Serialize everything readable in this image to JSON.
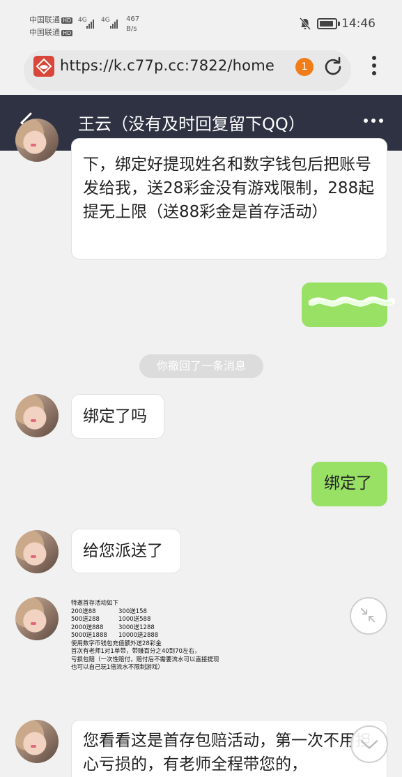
{
  "status_bar": {
    "carrier_1": "中国联通",
    "carrier_2": "中国联通",
    "hd": "HD",
    "signal_1": "4G",
    "signal_2": "4G",
    "speed_value": "467",
    "speed_unit": "B/s",
    "time": "14:46"
  },
  "browser": {
    "url": "https://k.c77p.cc:7822/home",
    "tab_count": "1"
  },
  "chat": {
    "title": "王云（没有及时回复留下QQ）",
    "messages": {
      "m1": "下，绑定好提现姓名和数字钱包后把账号发给我，送28彩金没有游戏限制，288起提无上限（送88彩金是首存活动）",
      "recall": "你撤回了一条消息",
      "m3": "绑定了吗",
      "m4": "绑定了",
      "m5": "给您派送了",
      "m7": "您看看这是首存包赔活动，第一次不用担心亏损的，有老师全程带您的，"
    },
    "promo": {
      "title": "特邀首存活动如下",
      "rows": [
        [
          "200送88",
          "300送158"
        ],
        [
          "500送288",
          "1000送588"
        ],
        [
          "2000送888",
          "3000送1288"
        ],
        [
          "5000送1888",
          "10000送2888"
        ]
      ],
      "line1": "使用数字币钱包充值额外送28彩金",
      "line2": "首次有老师1对1单带，带赚百分之40到70左右，",
      "line3": "亏损包赔（一次性赔付，赔付后不需要流水可以直接提现",
      "line4": "也可以自己玩1倍流水不限制游戏）"
    }
  },
  "colors": {
    "header_bg": "#2e3242",
    "outgoing_bubble": "#98e165",
    "incoming_bubble": "#ffffff",
    "badge": "#f07d1a"
  }
}
